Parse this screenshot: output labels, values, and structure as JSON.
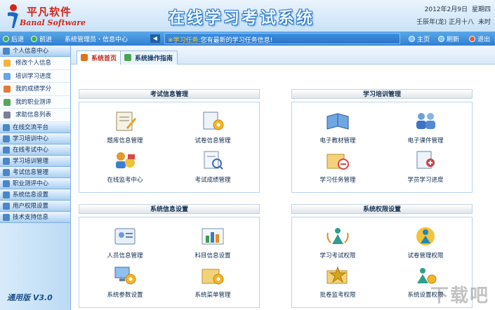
{
  "header": {
    "logo_cn": "平凡软件",
    "logo_en": "Banal Software",
    "title": "在线学习考试系统",
    "date_line1": "2012年2月9日",
    "weekday": "星期四",
    "date_line2": "壬辰年(龙) 正月十八",
    "time": "未时"
  },
  "toolbar": {
    "back_label": "后退",
    "forward_label": "前进",
    "user_info": "系统管理员・信息中心",
    "nav_left": "◀",
    "notice_prefix": "※学习任务:",
    "notice_text": "您有最新的学习任务信息!",
    "home_label": "主页",
    "refresh_label": "刷新",
    "exit_label": "退出"
  },
  "sidebar": {
    "groups": [
      {
        "label": "个人信息中心"
      },
      {
        "label": "在线交流平台"
      },
      {
        "label": "学习培训中心"
      },
      {
        "label": "在线考试中心"
      },
      {
        "label": "学习培训管理"
      },
      {
        "label": "考试信息管理"
      },
      {
        "label": "职业测评中心"
      },
      {
        "label": "系统信息设置"
      },
      {
        "label": "用户权限设置"
      },
      {
        "label": "技术支持信息"
      }
    ],
    "subitems": [
      {
        "label": "修改个人信息"
      },
      {
        "label": "培训学习进度"
      },
      {
        "label": "我的成绩学分"
      },
      {
        "label": "我的职业测评"
      },
      {
        "label": "求助信息列表"
      }
    ],
    "version": "通用版 V3.0"
  },
  "tabs": [
    {
      "label": "系统首页"
    },
    {
      "label": "系统操作指南"
    }
  ],
  "panels": {
    "exam": {
      "title": "考试信息管理",
      "items": [
        "题库信息管理",
        "试卷信息管理",
        "在线监考中心",
        "考试成绩管理"
      ]
    },
    "training": {
      "title": "学习培训管理",
      "items": [
        "电子教材管理",
        "电子课件管理",
        "学习任务管理",
        "学员学习进度"
      ]
    },
    "system": {
      "title": "系统信息设置",
      "items": [
        "人员信息管理",
        "科目信息设置",
        "系统参数设置",
        "系统菜单管理"
      ]
    },
    "permission": {
      "title": "系统权限设置",
      "items": [
        "学习考试权限",
        "试卷管理权限",
        "批卷监考权限",
        "系统设置权限"
      ]
    }
  },
  "watermark": "下载吧",
  "colors": {
    "accent_blue": "#2f7fd1",
    "brand_red": "#d2251b",
    "notice_yellow": "#ffd23a"
  }
}
